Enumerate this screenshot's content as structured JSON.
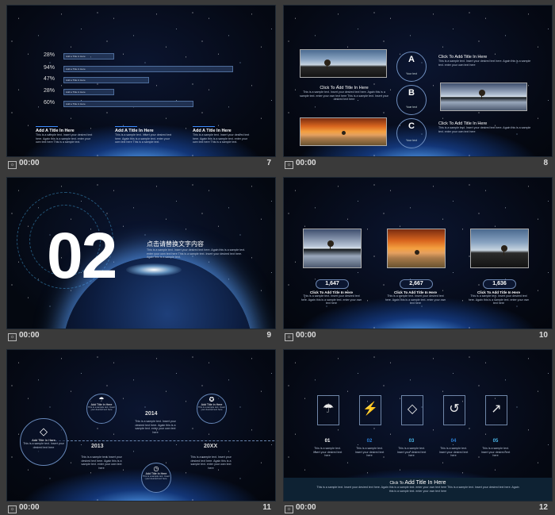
{
  "slides": [
    {
      "number": "7",
      "timer": "00:00",
      "bars": [
        {
          "pct": "28%",
          "label": "Add a Title in Here",
          "fraction": 0.28
        },
        {
          "pct": "94%",
          "label": "Add a Title in Here",
          "fraction": 0.94
        },
        {
          "pct": "47%",
          "label": "Add a Title in Here",
          "fraction": 0.47
        },
        {
          "pct": "28%",
          "label": "Add a Title in Here",
          "fraction": 0.28
        },
        {
          "pct": "60%",
          "label": "Add a Title in Here",
          "fraction": 0.6
        }
      ],
      "columns": [
        {
          "title": "Add A Title In Here",
          "body": "This is a sample text. Insert your desired text here. Again this is a sample text. enter your own text here This is a sample text."
        },
        {
          "title": "Add A Title In Here",
          "body": "This is a sample text. Insert your desired text here. Again this is a sample text. enter your own text here This is a sample text."
        },
        {
          "title": "Add A Title In Here",
          "body": "This is a sample text. Insert your desired text here. Again this is a sample text. enter your own text here This is a sample text."
        }
      ]
    },
    {
      "number": "8",
      "timer": "00:00",
      "center_title": "Click To Add Title In Here",
      "center_body": "This is a sample text. Insert your desired text here. Again this is a sample text. enter your own text here This is a sample text. Insert your desired text here",
      "circles": [
        {
          "letter": "A",
          "sub": "Your text"
        },
        {
          "letter": "B",
          "sub": "Your text"
        },
        {
          "letter": "C",
          "sub": "Your text"
        }
      ],
      "right_items": [
        {
          "title": "Click To Add Title In Here",
          "body": "This is a sample text. Insert your desired text here. Again this is a sample text. enter your own text here"
        },
        {
          "title": "Click To Add Title In Here",
          "body": "This is a sample text. Insert your desired text here. Again this is a sample text. enter your own text here"
        }
      ]
    },
    {
      "number": "9",
      "timer": "00:00",
      "big_number": "02",
      "title": "点击请替换文字内容",
      "body": "This is a sample text. Insert your desired text here. Again this is a sample text. enter your own text here This is a sample text. Insert your desired text here. Again this is a sample text."
    },
    {
      "number": "10",
      "timer": "00:00",
      "items": [
        {
          "stat": "1,647",
          "title": "Click To Add Title In Here",
          "body": "This is a sample text. Insert your desired text here. Again this is a sample text. enter your own text here"
        },
        {
          "stat": "2,667",
          "title": "Click To Add Title In Here",
          "body": "This is a sample text. Insert your desired text here. Again this is a sample text. enter your own text here"
        },
        {
          "stat": "1,636",
          "title": "Click To Add Title In Here",
          "body": "This is a sample text. Insert your desired text here. Again this is a sample text. enter your own text here"
        }
      ]
    },
    {
      "number": "11",
      "timer": "00:00",
      "nodes": [
        {
          "title": "Add Title In Here",
          "body": "This is a sample text. Insert your desired text here"
        },
        {
          "title": "Add Title In Here",
          "body": "This is a sample text. Insert your desired text here"
        },
        {
          "title": "Add Title In Here",
          "body": "This is a sample text. Insert your desired text here"
        },
        {
          "title": "Add Title In Here",
          "body": "This is a sample text. Insert your desired text here"
        }
      ],
      "years": [
        "2013",
        "2014",
        "20XX"
      ],
      "year_bodies": [
        "This is a sample text. Insert your desired text here. Again this is a sample text. enter your own text here",
        "This is a sample text. Insert your desired text here. Again this is a sample text. enter your own text here",
        "This is a sample text. Insert your desired text here. Again this is a sample text. enter your own text here"
      ]
    },
    {
      "number": "12",
      "timer": "00:00",
      "icons": [
        {
          "num": "01",
          "icon": "umbrella-icon",
          "glyph": "☂",
          "color": "#ffffff"
        },
        {
          "num": "02",
          "icon": "shield-bolt-icon",
          "glyph": "⚡",
          "color": "#2c7fd6"
        },
        {
          "num": "03",
          "icon": "diamond-icon",
          "glyph": "◇",
          "color": "#49b6e8"
        },
        {
          "num": "04",
          "icon": "history-icon",
          "glyph": "↺",
          "color": "#2c7fd6"
        },
        {
          "num": "05",
          "icon": "growth-icon",
          "glyph": "↗",
          "color": "#49b6e8"
        }
      ],
      "icon_body": "This is a sample text. Insert your desired text here",
      "bottom_prefix": "Click To",
      "bottom_title": "Add Title In Here",
      "bottom_body": "This is a sample text. Insert your desired text here. Again this is a sample text. enter your own text here This is a sample text. Insert your desired text here. Again this is a sample text. enter your own text here"
    }
  ]
}
